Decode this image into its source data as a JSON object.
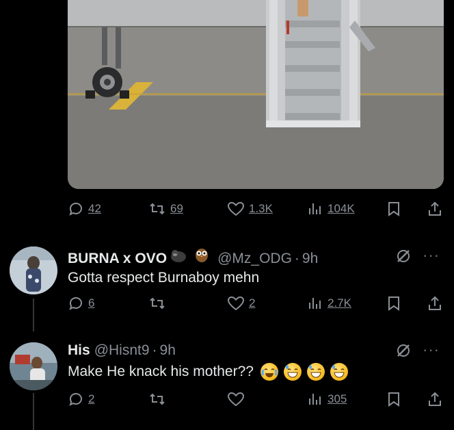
{
  "tweet_main": {
    "actions": {
      "replies": "42",
      "reposts": "69",
      "likes": "1.3K",
      "views": "104K"
    }
  },
  "replies": [
    {
      "name": "BURNA x OVO",
      "name_emoji": [
        "gorilla-emoji",
        "owl-emoji"
      ],
      "handle": "@Mz_ODG",
      "time": "9h",
      "text": "Gotta respect Burnaboy mehn",
      "actions": {
        "replies": "6",
        "reposts": "",
        "likes": "2",
        "views": "2.7K"
      }
    },
    {
      "name": "His",
      "handle": "@Hisnt9",
      "time": "9h",
      "text": "Make He knack his mother??",
      "text_emoji": [
        "crying-laughing-emoji",
        "grinning-sweat-emoji",
        "grinning-sweat-emoji",
        "grinning-sweat-emoji"
      ],
      "actions": {
        "replies": "2",
        "reposts": "",
        "likes": "",
        "views": "305"
      }
    }
  ],
  "separator": "·",
  "more_label": "···",
  "colors": {
    "background": "#000000",
    "text": "#e7e9ea",
    "muted": "#71767b",
    "thread_line": "#333639"
  }
}
